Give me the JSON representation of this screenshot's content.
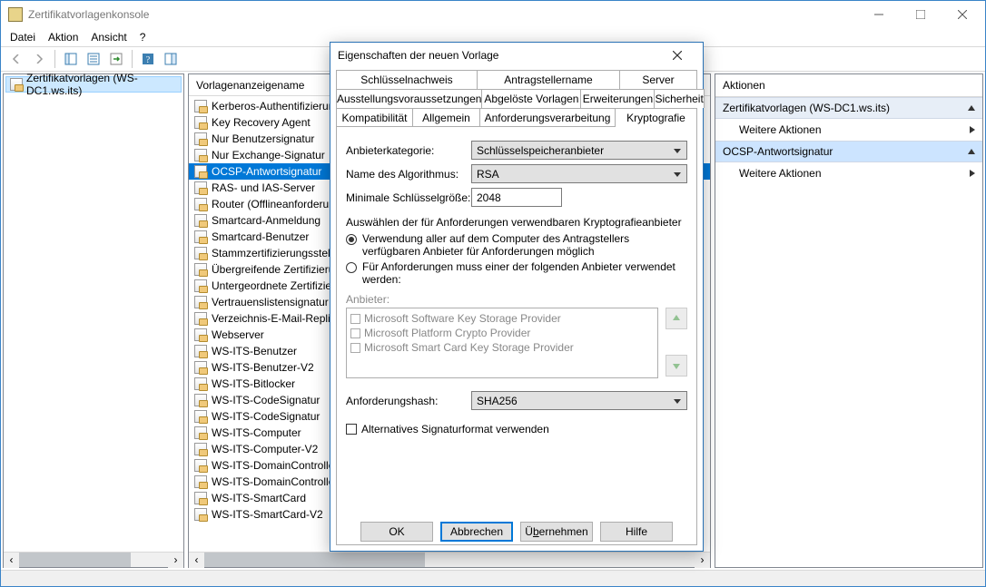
{
  "window_title": "Zertifikatvorlagenkonsole",
  "menu": [
    "Datei",
    "Aktion",
    "Ansicht",
    "?"
  ],
  "tree_item": "Zertifikatvorlagen (WS-DC1.ws.its)",
  "list_header": "Vorlagenanzeigename",
  "templates": [
    "Kerberos-Authentifizierung",
    "Key Recovery Agent",
    "Nur Benutzersignatur",
    "Nur Exchange-Signatur",
    "OCSP-Antwortsignatur",
    "RAS- und IAS-Server",
    "Router (Offlineanforderung)",
    "Smartcard-Anmeldung",
    "Smartcard-Benutzer",
    "Stammzertifizierungsstelle",
    "Übergreifende Zertifizierungsstelle",
    "Untergeordnete Zertifizierungsstelle",
    "Vertrauenslistensignatur",
    "Verzeichnis-E-Mail-Replikation",
    "Webserver",
    "WS-ITS-Benutzer",
    "WS-ITS-Benutzer-V2",
    "WS-ITS-Bitlocker",
    "WS-ITS-CodeSignatur",
    "WS-ITS-CodeSignatur",
    "WS-ITS-Computer",
    "WS-ITS-Computer-V2",
    "WS-ITS-DomainController",
    "WS-ITS-DomainController",
    "WS-ITS-SmartCard",
    "WS-ITS-SmartCard-V2"
  ],
  "selected_template_index": 4,
  "actions": {
    "title": "Aktionen",
    "group1": "Zertifikatvorlagen (WS-DC1.ws.its)",
    "more1": "Weitere Aktionen",
    "group2": "OCSP-Antwortsignatur",
    "more2": "Weitere Aktionen"
  },
  "dialog": {
    "title": "Eigenschaften der neuen Vorlage",
    "tabs_row1": [
      "Schlüsselnachweis",
      "Antragstellername",
      "Server"
    ],
    "tabs_row2": [
      "Ausstellungsvoraussetzungen",
      "Abgelöste Vorlagen",
      "Erweiterungen",
      "Sicherheit"
    ],
    "tabs_row3": [
      "Kompatibilität",
      "Allgemein",
      "Anforderungsverarbeitung",
      "Kryptografie"
    ],
    "active_tab": "Kryptografie",
    "fields": {
      "provider_cat_label": "Anbieterkategorie:",
      "provider_cat_value": "Schlüsselspeicheranbieter",
      "algo_label": "Name des Algorithmus:",
      "algo_value": "RSA",
      "keysize_label": "Minimale Schlüsselgröße:",
      "keysize_value": "2048"
    },
    "subhead": "Auswählen der für Anforderungen verwendbaren Kryptografieanbieter",
    "radio1": "Verwendung aller auf dem Computer des Antragstellers verfügbaren Anbieter für Anforderungen möglich",
    "radio2": "Für Anforderungen muss einer der folgenden Anbieter verwendet werden:",
    "providers_label": "Anbieter:",
    "providers": [
      "Microsoft Software Key Storage Provider",
      "Microsoft Platform Crypto Provider",
      "Microsoft Smart Card Key Storage Provider"
    ],
    "hash_label": "Anforderungshash:",
    "hash_value": "SHA256",
    "alt_sig": "Alternatives Signaturformat verwenden",
    "buttons": {
      "ok": "OK",
      "cancel": "Abbrechen",
      "apply_pre": "Ü",
      "apply_u": "b",
      "apply_post": "ernehmen",
      "help": "Hilfe"
    }
  }
}
